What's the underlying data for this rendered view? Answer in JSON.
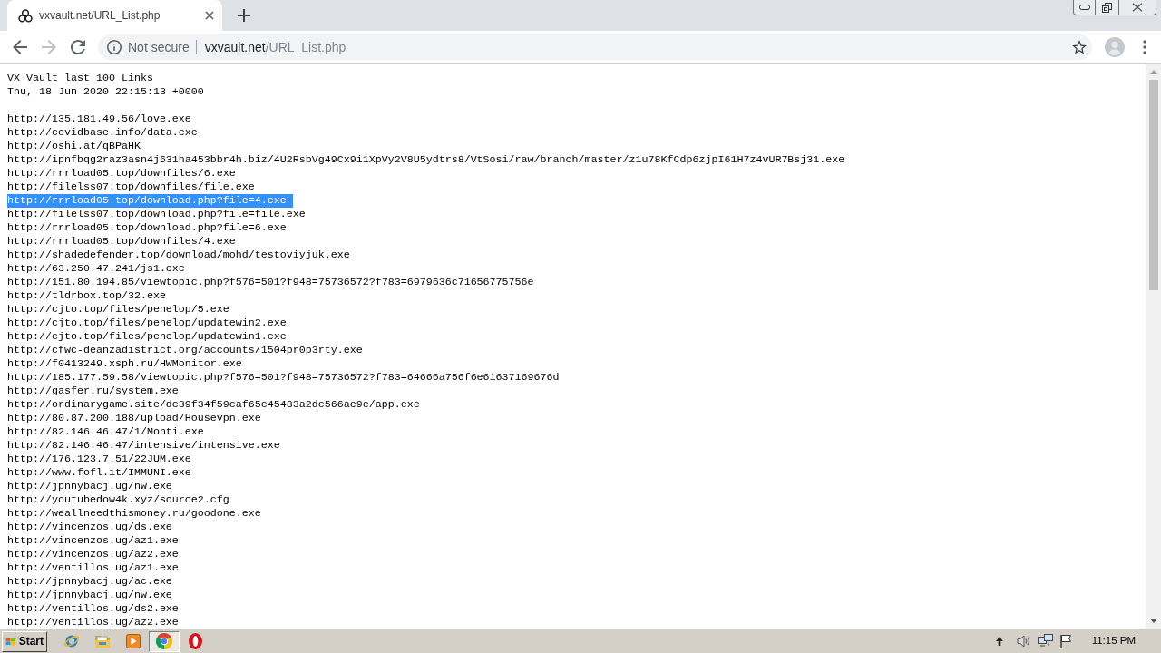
{
  "browser_window": {
    "tab": {
      "title": "vxvault.net/URL_List.php",
      "selected": true
    },
    "toolbar": {
      "back": {
        "disabled": false
      },
      "forward": {
        "disabled": true
      }
    },
    "address_bar": {
      "security_label": "Not secure",
      "host": "vxvault.net",
      "path": "/URL_List.php"
    }
  },
  "page": {
    "heading": "VX Vault last 100 Links",
    "timestamp": "Thu, 18 Jun 2020 22:15:13 +0000",
    "links": [
      {
        "url": "http://135.181.49.56/love.exe",
        "selected": false
      },
      {
        "url": "http://covidbase.info/data.exe",
        "selected": false
      },
      {
        "url": "http://oshi.at/qBPaHK",
        "selected": false
      },
      {
        "url": "http://ipnfbqg2raz3asn4j631ha453bbr4h.biz/4U2RsbVg49Cx9i1XpVy2V8U5ydtrs8/VtSosi/raw/branch/master/z1u78KfCdp6zjpI61H7z4vUR7Bsj31.exe",
        "selected": false
      },
      {
        "url": "http://rrrload05.top/downfiles/6.exe",
        "selected": false
      },
      {
        "url": "http://filelss07.top/downfiles/file.exe",
        "selected": false
      },
      {
        "url": "http://rrrload05.top/download.php?file=4.exe",
        "selected": true
      },
      {
        "url": "http://filelss07.top/download.php?file=file.exe",
        "selected": false
      },
      {
        "url": "http://rrrload05.top/download.php?file=6.exe",
        "selected": false
      },
      {
        "url": "http://rrrload05.top/downfiles/4.exe",
        "selected": false
      },
      {
        "url": "http://shadedefender.top/download/mohd/testoviyjuk.exe",
        "selected": false
      },
      {
        "url": "http://63.250.47.241/js1.exe",
        "selected": false
      },
      {
        "url": "http://151.80.194.85/viewtopic.php?f576=501?f948=75736572?f783=6979636c71656775756e",
        "selected": false
      },
      {
        "url": "http://tldrbox.top/32.exe",
        "selected": false
      },
      {
        "url": "http://cjto.top/files/penelop/5.exe",
        "selected": false
      },
      {
        "url": "http://cjto.top/files/penelop/updatewin2.exe",
        "selected": false
      },
      {
        "url": "http://cjto.top/files/penelop/updatewin1.exe",
        "selected": false
      },
      {
        "url": "http://cfwc-deanzadistrict.org/accounts/1504pr0p3rty.exe",
        "selected": false
      },
      {
        "url": "http://f0413249.xsph.ru/HWMonitor.exe",
        "selected": false
      },
      {
        "url": "http://185.177.59.58/viewtopic.php?f576=501?f948=75736572?f783=64666a756f6e61637169676d",
        "selected": false
      },
      {
        "url": "http://gasfer.ru/system.exe",
        "selected": false
      },
      {
        "url": "http://ordinarygame.site/dc39f34f59caf65c45483a2dc566ae9e/app.exe",
        "selected": false
      },
      {
        "url": "http://80.87.200.188/upload/Housevpn.exe",
        "selected": false
      },
      {
        "url": "http://82.146.46.47/1/Monti.exe",
        "selected": false
      },
      {
        "url": "http://82.146.46.47/intensive/intensive.exe",
        "selected": false
      },
      {
        "url": "http://176.123.7.51/22JUM.exe",
        "selected": false
      },
      {
        "url": "http://www.fofl.it/IMMUNI.exe",
        "selected": false
      },
      {
        "url": "http://jpnnybacj.ug/nw.exe",
        "selected": false
      },
      {
        "url": "http://youtubedow4k.xyz/source2.cfg",
        "selected": false
      },
      {
        "url": "http://weallneedthismoney.ru/goodone.exe",
        "selected": false
      },
      {
        "url": "http://vincenzos.ug/ds.exe",
        "selected": false
      },
      {
        "url": "http://vincenzos.ug/az1.exe",
        "selected": false
      },
      {
        "url": "http://vincenzos.ug/az2.exe",
        "selected": false
      },
      {
        "url": "http://ventillos.ug/az1.exe",
        "selected": false
      },
      {
        "url": "http://jpnnybacj.ug/ac.exe",
        "selected": false
      },
      {
        "url": "http://jpnnybacj.ug/nw.exe",
        "selected": false
      },
      {
        "url": "http://ventillos.ug/ds2.exe",
        "selected": false
      },
      {
        "url": "http://ventillos.ug/az2.exe",
        "selected": false
      }
    ]
  },
  "taskbar": {
    "start_label": "Start",
    "apps": [
      {
        "kind": "globe",
        "selected": false
      },
      {
        "kind": "folder",
        "selected": false
      },
      {
        "kind": "player",
        "selected": false
      },
      {
        "kind": "circle",
        "selected": true
      },
      {
        "kind": "ring",
        "selected": false
      }
    ],
    "clock": "11:15 PM"
  }
}
